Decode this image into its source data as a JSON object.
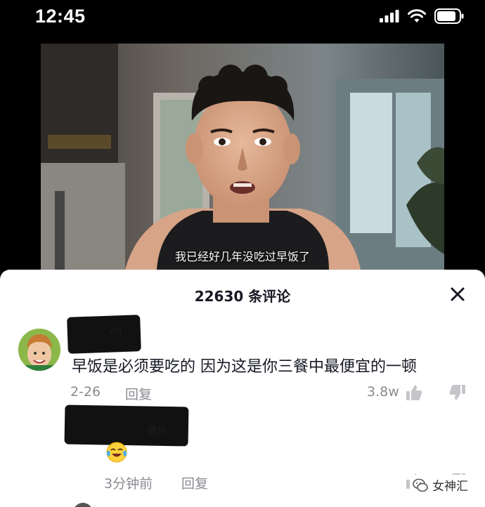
{
  "status_bar": {
    "time": "12:45"
  },
  "video": {
    "subtitle": "我已经好几年没吃过早饭了"
  },
  "comments_panel": {
    "title": "22630 条评论",
    "comments": [
      {
        "username_redacted": "ed",
        "text": "早饭是必须要吃的 因为这是你三餐中最便宜的一顿",
        "date": "2-26",
        "reply_label": "回复",
        "likes": "3.8w"
      },
      {
        "username_redacted": "星辰",
        "emoji_icon": "crying-laughing-emoji-icon",
        "time": "3分钟前",
        "reply_label": "回复"
      }
    ]
  },
  "watermark": {
    "text": "女神汇"
  },
  "colors": {
    "text_primary": "#161823",
    "text_secondary": "#8a8b91",
    "sheet_bg": "#ffffff"
  }
}
